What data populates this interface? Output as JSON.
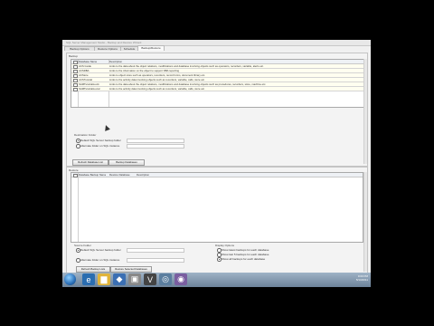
{
  "window": {
    "title": "SQL Server Management Studio - Backup and Restore Wizard"
  },
  "tabs": [
    "Backup Options",
    "Restore Options",
    "Schedule",
    "Backup/Restore"
  ],
  "backup": {
    "group_label": "Backup",
    "columns": [
      "Database Name",
      "Description"
    ],
    "rows": [
      {
        "name": "ACS Guide",
        "desc": "Links to the data about the object relations, modifications and database involving objects such as operators, recorders, variable, alerts etc."
      },
      {
        "name": "ACSDBA",
        "desc": "Links to the information on the object to support DBA reporting"
      },
      {
        "name": "ACStore",
        "desc": "Links to object store such as operators, recorders, record forms, document library etc."
      },
      {
        "name": "ACSTutorial",
        "desc": "Links to the activity data involving objects such as recorders, variable, calls, store etc."
      },
      {
        "name": "SAMTutorialsLock",
        "desc": "Links to the data about the object relations, modifications and database involving objects such as procedures, recorders, store, machine etc."
      },
      {
        "name": "SAMTutorialsLocal",
        "desc": "Links to the activity data involving objects such as recorders, variable, calls, store etc."
      }
    ],
    "destination": {
      "label": "Destination Folder",
      "options": [
        "Default SQL Server backup folder",
        "Alternate folder on SQL instance"
      ]
    },
    "buttons": [
      "Refresh Database List",
      "Backup Databases"
    ]
  },
  "restore": {
    "group_label": "Restore",
    "columns": [
      "Database Backup Name",
      "Restore Database",
      "Description"
    ],
    "source": {
      "label": "Source Folder",
      "options": [
        "Default SQL Server backup folder",
        "Alternate folder on SQL instance"
      ]
    },
    "display": {
      "label": "Display Options",
      "options": [
        "Show latest backups for each database",
        "Show last 5 backups for each database",
        "Show all backups for each database"
      ]
    },
    "buttons": [
      "Refresh Backup Lists",
      "Restore Selected Databases"
    ]
  },
  "taskbar": {
    "time": "9:00 PM",
    "date": "5/13/2011"
  }
}
